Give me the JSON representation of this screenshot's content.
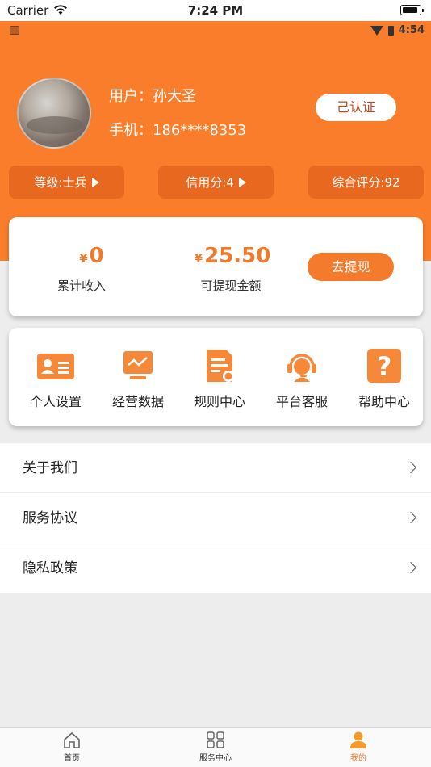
{
  "ios_status": {
    "carrier": "Carrier",
    "time": "7:24 PM"
  },
  "android_status": {
    "time": "4:54"
  },
  "profile": {
    "name_label": "用户：孙大圣",
    "phone_label": "手机：186****8353",
    "verified_label": "己认证"
  },
  "stats": [
    {
      "label": "等级:士兵"
    },
    {
      "label": "信用分:4"
    },
    {
      "label": "综合评分:92"
    }
  ],
  "income": {
    "currency": "¥",
    "total_value": "0",
    "total_label": "累计收入",
    "withdrawable_value": "25.50",
    "withdrawable_label": "可提现金额",
    "withdraw_button": "去提现"
  },
  "menu": [
    {
      "label": "个人设置",
      "icon": "id-card-icon"
    },
    {
      "label": "经营数据",
      "icon": "chart-monitor-icon"
    },
    {
      "label": "规则中心",
      "icon": "document-rules-icon"
    },
    {
      "label": "平台客服",
      "icon": "headset-support-icon"
    },
    {
      "label": "帮助中心",
      "icon": "question-help-icon"
    }
  ],
  "list": [
    {
      "label": "关于我们"
    },
    {
      "label": "服务协议"
    },
    {
      "label": "隐私政策"
    }
  ],
  "tabs": [
    {
      "label": "首页",
      "icon": "home-icon",
      "active": false
    },
    {
      "label": "服务中心",
      "icon": "grid-icon",
      "active": false
    },
    {
      "label": "我的",
      "icon": "user-icon",
      "active": true
    }
  ],
  "colors": {
    "accent": "#fa7d2c",
    "accent_dark": "#e9681f",
    "verified_text": "#c4451a",
    "background": "#ededed"
  }
}
